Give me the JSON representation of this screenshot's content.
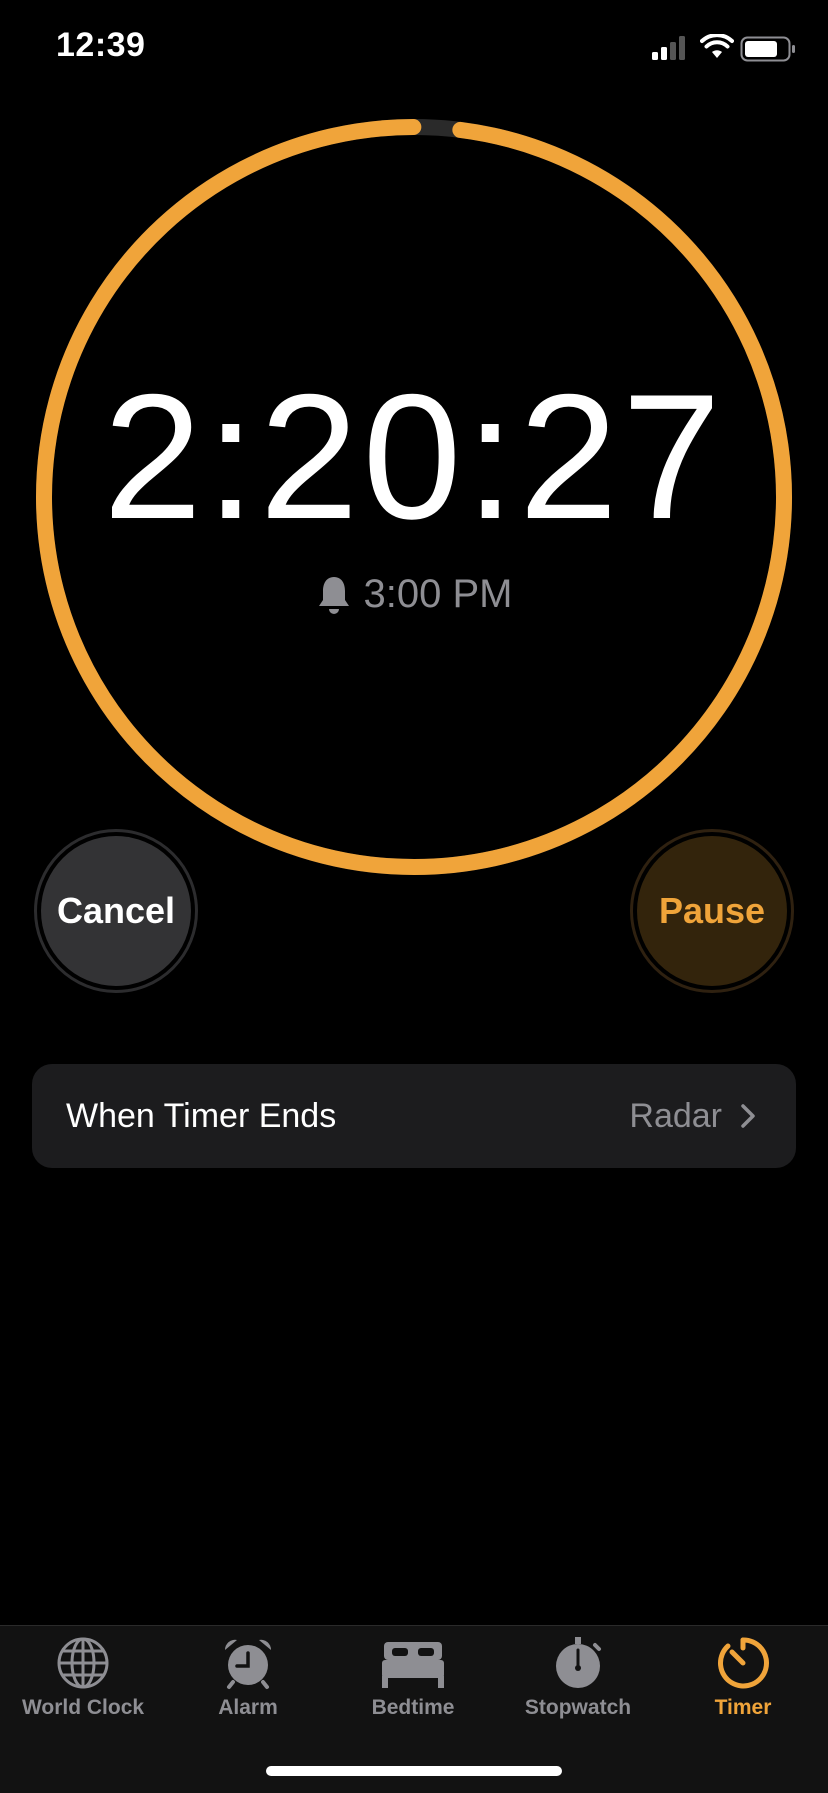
{
  "status_bar": {
    "time": "12:39",
    "icons": [
      "cellular-signal-icon",
      "wifi-icon",
      "battery-icon"
    ]
  },
  "timer": {
    "remaining": "2:20:27",
    "ends_at": "3:00 PM",
    "progress_remaining_fraction": 0.98,
    "ring_color": "#f0a43a"
  },
  "buttons": {
    "cancel": "Cancel",
    "pause": "Pause"
  },
  "when_timer_ends": {
    "label": "When Timer Ends",
    "value": "Radar"
  },
  "tabs": [
    {
      "label": "World Clock",
      "icon": "globe-icon",
      "active": false
    },
    {
      "label": "Alarm",
      "icon": "alarm-clock-icon",
      "active": false
    },
    {
      "label": "Bedtime",
      "icon": "bed-icon",
      "active": false
    },
    {
      "label": "Stopwatch",
      "icon": "stopwatch-icon",
      "active": false
    },
    {
      "label": "Timer",
      "icon": "timer-icon",
      "active": true
    }
  ],
  "colors": {
    "accent": "#f0a43a",
    "secondary_text": "#8e8e93",
    "cell_background": "#1c1c1e"
  }
}
